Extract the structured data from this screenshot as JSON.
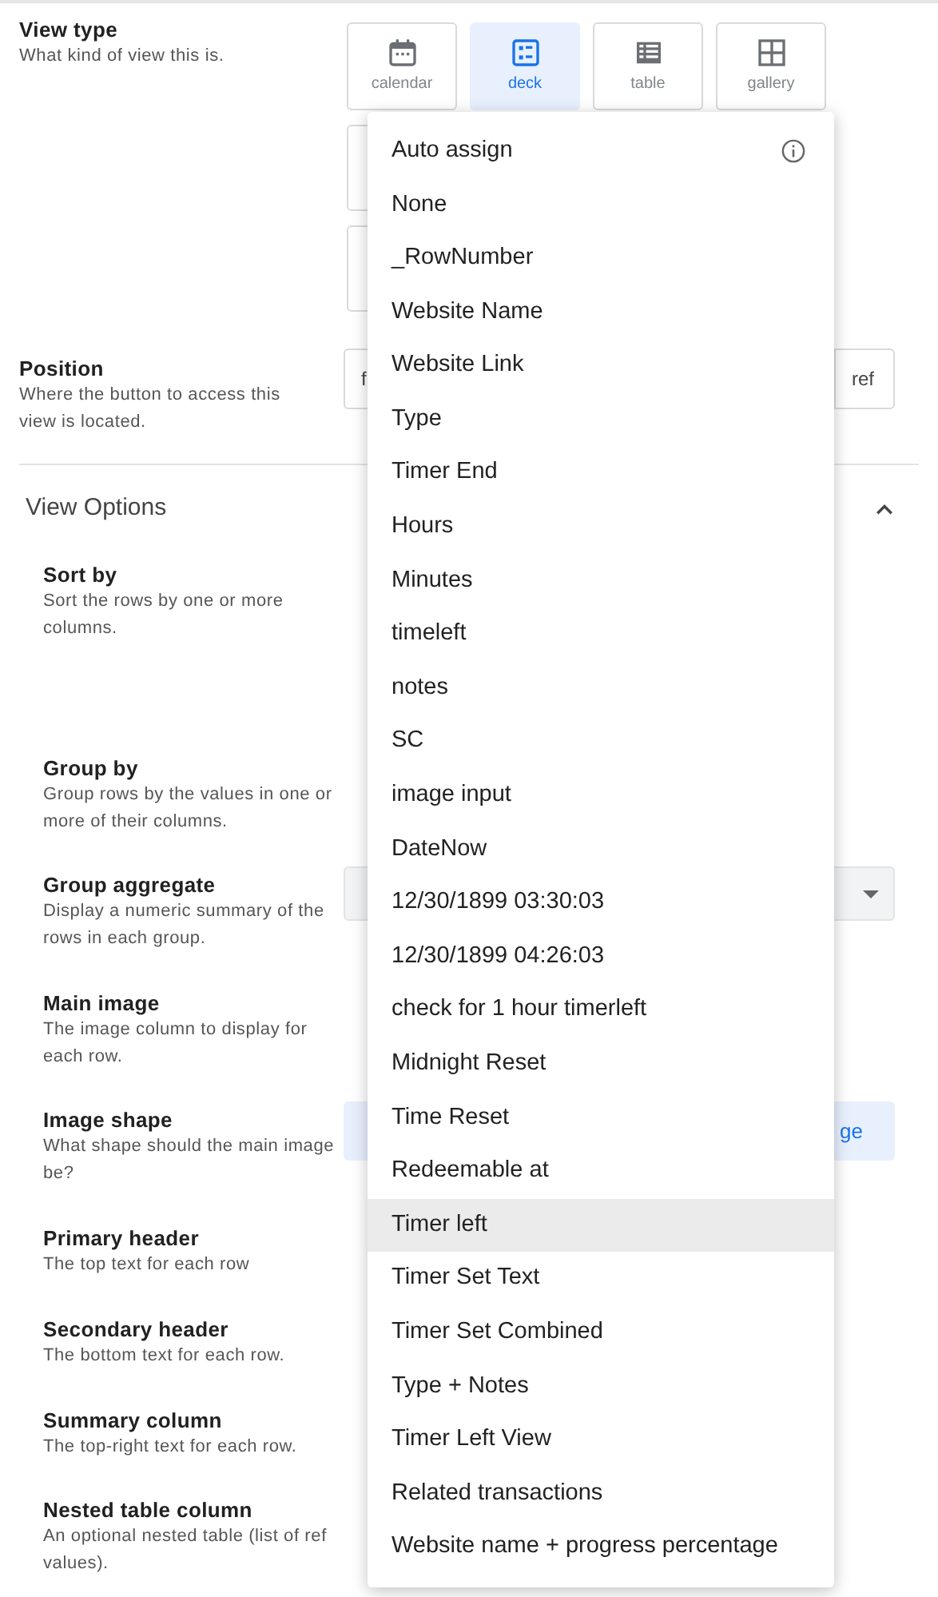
{
  "view_type": {
    "label": "View type",
    "description": "What kind of view this is.",
    "options": [
      {
        "label": "calendar",
        "kind": "calendar",
        "selected": false
      },
      {
        "label": "deck",
        "kind": "deck",
        "selected": true
      },
      {
        "label": "table",
        "kind": "table",
        "selected": false
      },
      {
        "label": "gallery",
        "kind": "gallery",
        "selected": false
      }
    ]
  },
  "position": {
    "label": "Position",
    "description": "Where the button to access this view is located.",
    "segments": [
      "f",
      "ref"
    ]
  },
  "view_options": {
    "title": "View Options",
    "expanded": true,
    "fields": [
      {
        "label": "Sort by",
        "description": "Sort the rows by one or more columns.",
        "kind": "none"
      },
      {
        "label": "Group by",
        "description": "Group rows by the values in one or more of their columns.",
        "kind": "none"
      },
      {
        "label": "Group aggregate",
        "description": "Display a numeric summary of the rows in each group.",
        "kind": "dropdown"
      },
      {
        "label": "Main image",
        "description": "The image column to display for each row.",
        "kind": "none"
      },
      {
        "label": "Image shape",
        "description": "What shape should the main image be?",
        "kind": "button",
        "control_text": "ge"
      },
      {
        "label": "Primary header",
        "description": "The top text for each row",
        "kind": "none"
      },
      {
        "label": "Secondary header",
        "description": "The bottom text for each row.",
        "kind": "none"
      },
      {
        "label": "Summary column",
        "description": "The top-right text for each row.",
        "kind": "none"
      },
      {
        "label": "Nested table column",
        "description": "An optional nested table (list of ref values).",
        "kind": "none"
      }
    ]
  },
  "dropdown": {
    "items": [
      {
        "label": "Auto assign",
        "info": true,
        "highlighted": false
      },
      {
        "label": "None",
        "info": false,
        "highlighted": false
      },
      {
        "label": "_RowNumber",
        "info": false,
        "highlighted": false
      },
      {
        "label": "Website Name",
        "info": false,
        "highlighted": false
      },
      {
        "label": "Website Link",
        "info": false,
        "highlighted": false
      },
      {
        "label": "Type",
        "info": false,
        "highlighted": false
      },
      {
        "label": "Timer End",
        "info": false,
        "highlighted": false
      },
      {
        "label": "Hours",
        "info": false,
        "highlighted": false
      },
      {
        "label": "Minutes",
        "info": false,
        "highlighted": false
      },
      {
        "label": "timeleft",
        "info": false,
        "highlighted": false
      },
      {
        "label": "notes",
        "info": false,
        "highlighted": false
      },
      {
        "label": "SC",
        "info": false,
        "highlighted": false
      },
      {
        "label": "image input",
        "info": false,
        "highlighted": false
      },
      {
        "label": "DateNow",
        "info": false,
        "highlighted": false
      },
      {
        "label": "12/30/1899 03:30:03",
        "info": false,
        "highlighted": false
      },
      {
        "label": "12/30/1899 04:26:03",
        "info": false,
        "highlighted": false
      },
      {
        "label": "check for 1 hour timerleft",
        "info": false,
        "highlighted": false
      },
      {
        "label": "Midnight Reset",
        "info": false,
        "highlighted": false
      },
      {
        "label": "Time Reset",
        "info": false,
        "highlighted": false
      },
      {
        "label": "Redeemable at",
        "info": false,
        "highlighted": false
      },
      {
        "label": "Timer left",
        "info": false,
        "highlighted": true
      },
      {
        "label": "Timer Set Text",
        "info": false,
        "highlighted": false
      },
      {
        "label": "Timer Set Combined",
        "info": false,
        "highlighted": false
      },
      {
        "label": "Type + Notes",
        "info": false,
        "highlighted": false
      },
      {
        "label": "Timer Left View",
        "info": false,
        "highlighted": false
      },
      {
        "label": "Related transactions",
        "info": false,
        "highlighted": false
      },
      {
        "label": "Website name + progress percentage",
        "info": false,
        "highlighted": false
      }
    ]
  }
}
